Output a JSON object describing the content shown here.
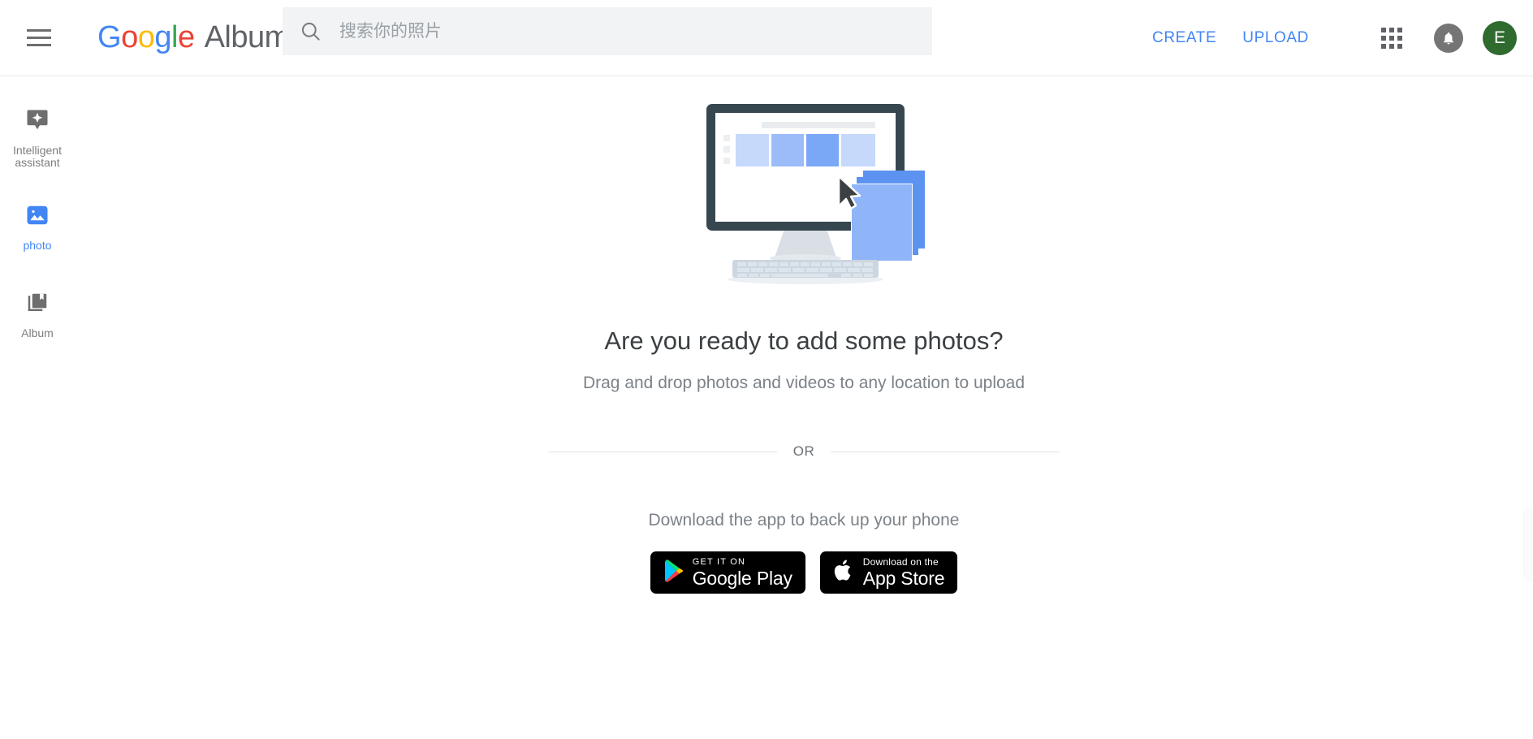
{
  "header": {
    "menu_icon": "hamburger-menu-icon",
    "brand_google": "Google",
    "brand_app": "Album",
    "search": {
      "icon": "search-icon",
      "value": "",
      "placeholder": "搜索你的照片"
    },
    "create_label": "CREATE",
    "upload_label": "UPLOAD",
    "apps_icon": "apps-grid-icon",
    "notifications_icon": "bell-icon",
    "avatar_initial": "E"
  },
  "sidebar": {
    "items": [
      {
        "label": "Intelligent assistant",
        "icon": "assistant-sparkle-icon",
        "active": false
      },
      {
        "label": "photo",
        "icon": "photo-icon",
        "active": true
      },
      {
        "label": "Album",
        "icon": "album-book-icon",
        "active": false
      }
    ]
  },
  "main": {
    "illustration": "monitor-drag-drop-photos-illustration",
    "headline": "Are you ready to add some photos?",
    "subhead": "Drag and drop photos and videos to any location to upload",
    "or_text": "OR",
    "download_text": "Download the app to back up your phone",
    "badges": [
      {
        "small": "GET IT ON",
        "large": "Google Play",
        "icon": "google-play-icon"
      },
      {
        "small": "Download on the",
        "large": "App Store",
        "icon": "apple-icon"
      }
    ]
  },
  "colors": {
    "accent_blue": "#4285F4",
    "google_red": "#EA4335",
    "google_yellow": "#FBBC05",
    "google_green": "#34A853",
    "avatar_green": "#2f6a2f",
    "text_primary": "#3c4043",
    "text_secondary": "#7c8288",
    "search_bg": "#f1f3f4",
    "monitor_frame": "#37474f",
    "photo_tile_light": "#c6d9fb",
    "photo_tile_mid": "#9bbcf9",
    "photo_tile_dark": "#7aa8f7"
  }
}
